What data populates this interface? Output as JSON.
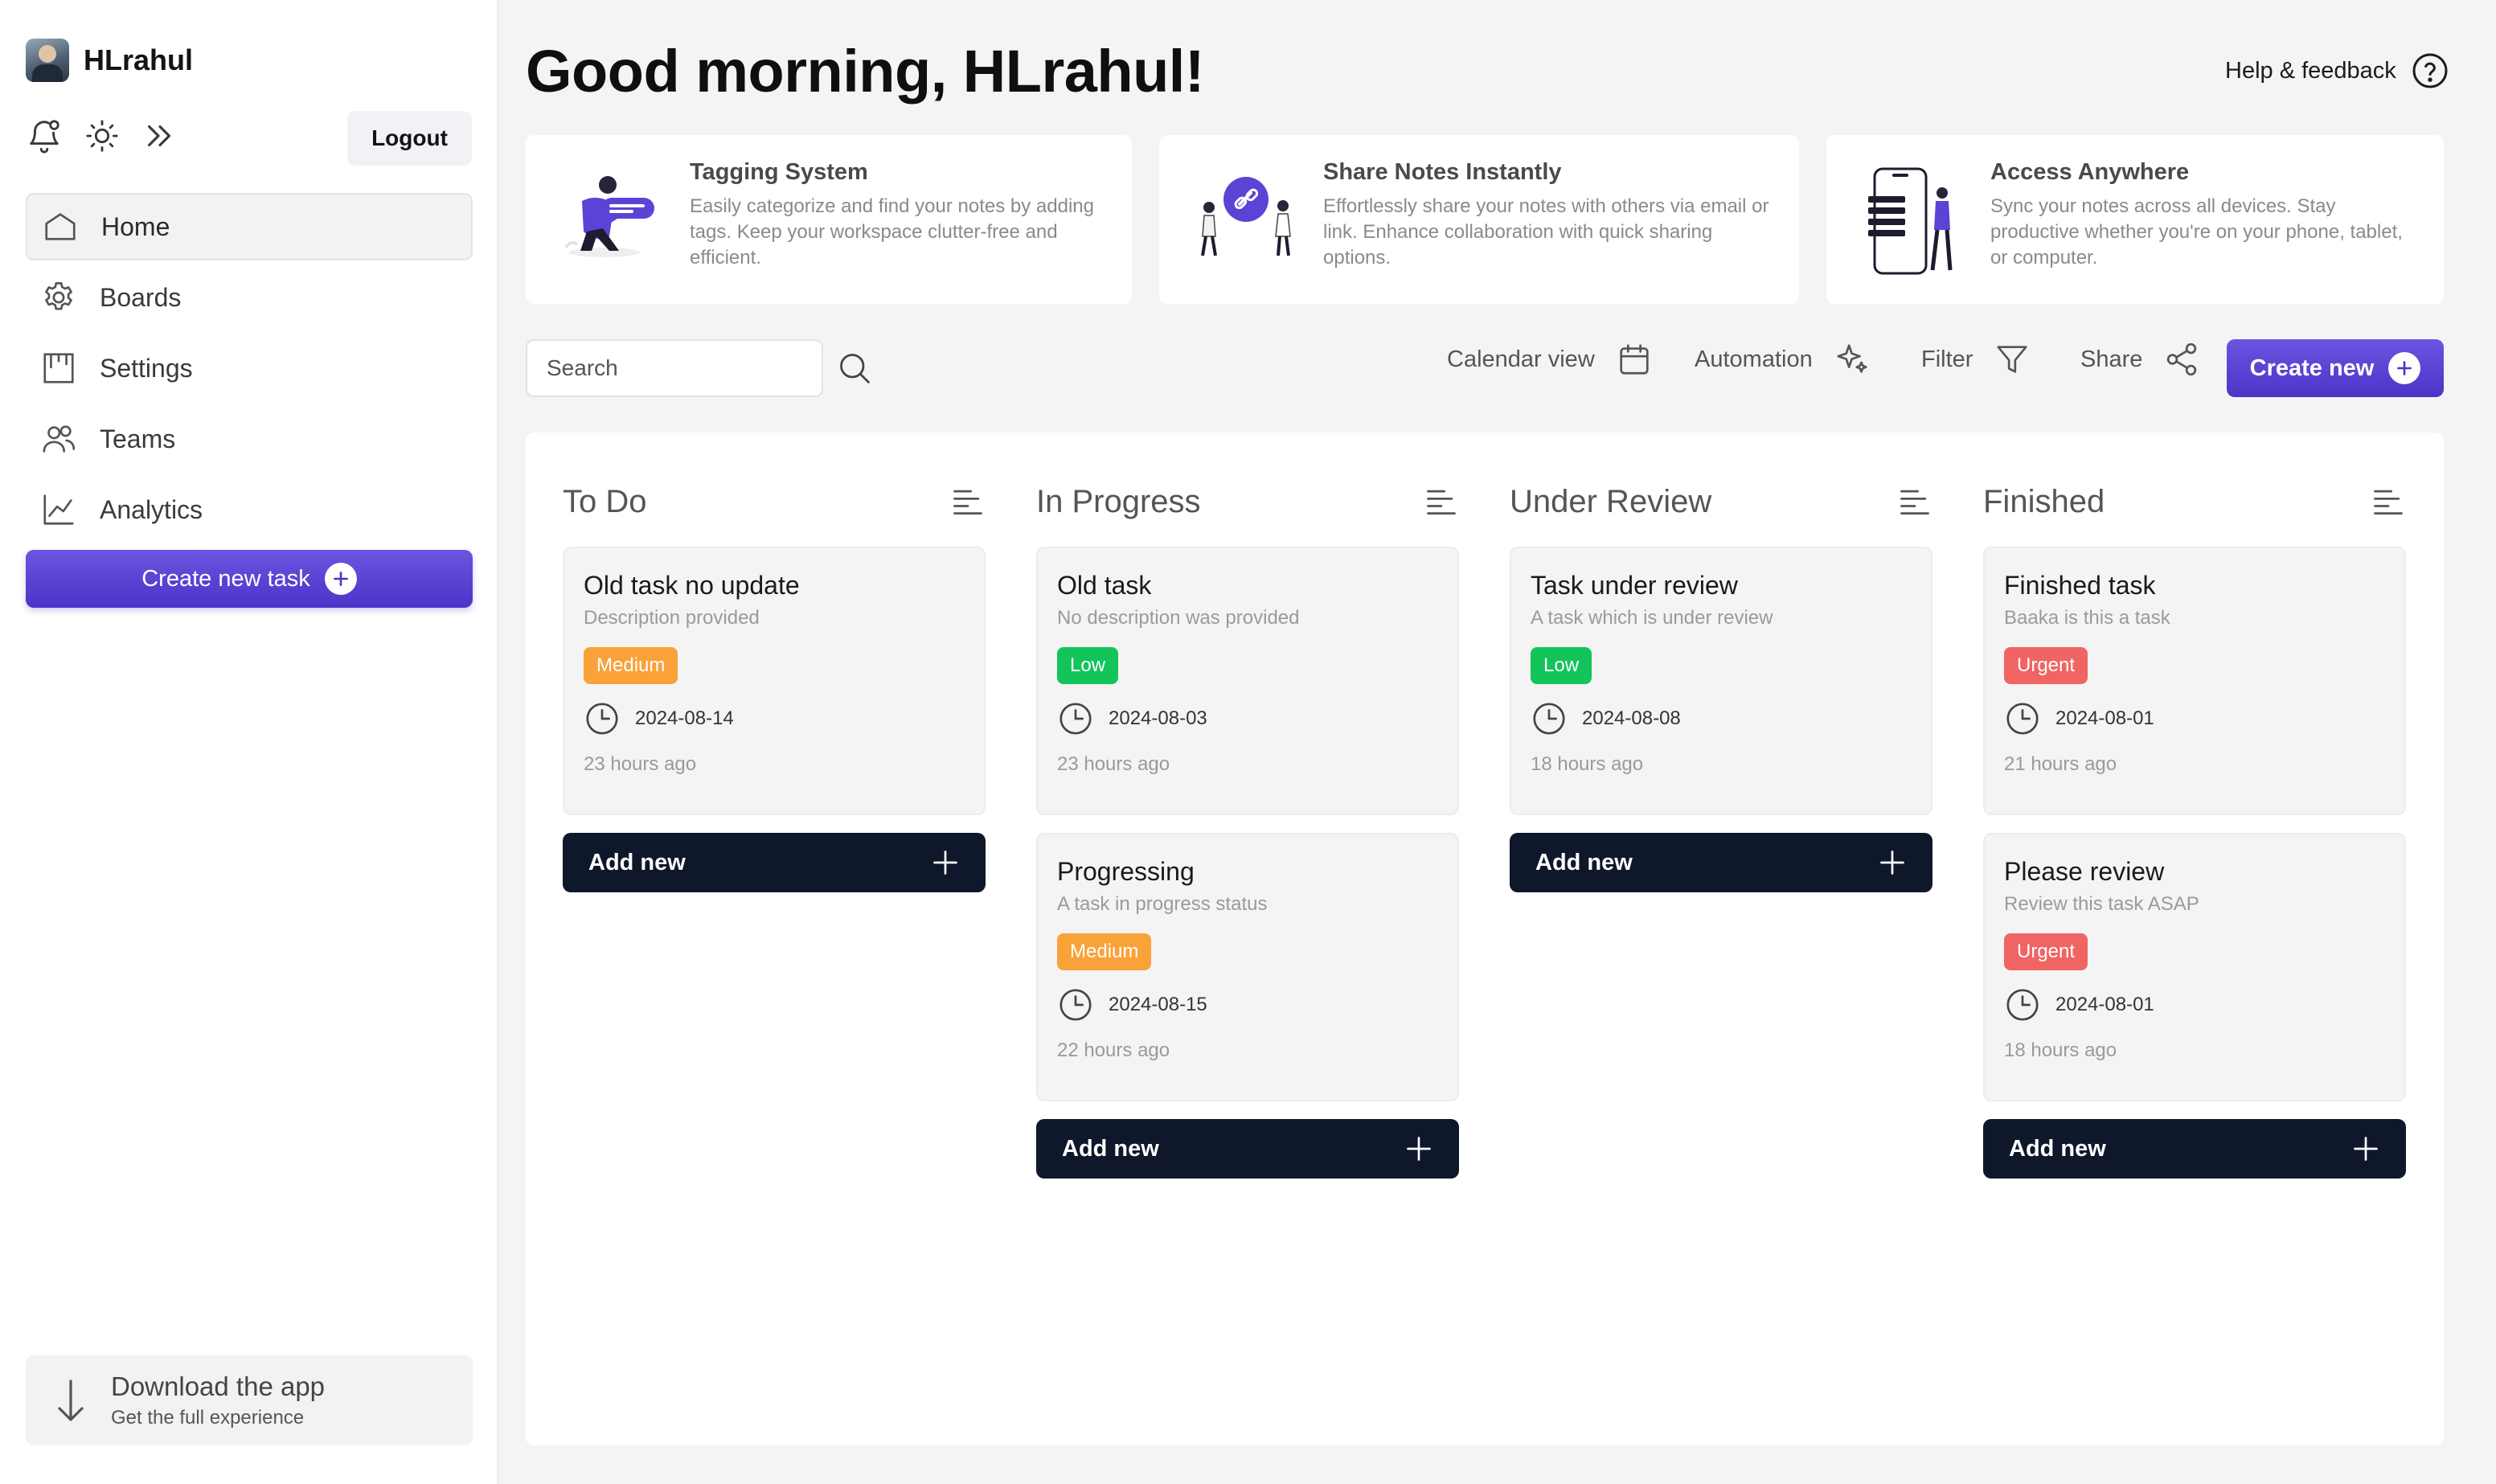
{
  "user": {
    "name": "HLrahul"
  },
  "sidebar": {
    "logout_label": "Logout",
    "nav": [
      {
        "label": "Home",
        "icon": "home-icon",
        "active": true
      },
      {
        "label": "Boards",
        "icon": "gear-icon"
      },
      {
        "label": "Settings",
        "icon": "kanban-icon"
      },
      {
        "label": "Teams",
        "icon": "users-icon"
      },
      {
        "label": "Analytics",
        "icon": "chart-line-icon"
      }
    ],
    "create_task_label": "Create new task",
    "download": {
      "title": "Download the app",
      "subtitle": "Get the full experience"
    }
  },
  "header": {
    "greeting": "Good morning, HLrahul!",
    "help_label": "Help & feedback"
  },
  "features": [
    {
      "title": "Tagging System",
      "description": "Easily categorize and find your notes by adding tags. Keep your workspace clutter-free and efficient."
    },
    {
      "title": "Share Notes Instantly",
      "description": "Effortlessly share your notes with others via email or link. Enhance collaboration with quick sharing options."
    },
    {
      "title": "Access Anywhere",
      "description": "Sync your notes across all devices. Stay productive whether you're on your phone, tablet, or computer."
    }
  ],
  "toolbar": {
    "search_placeholder": "Search",
    "calendar_label": "Calendar view",
    "automation_label": "Automation",
    "filter_label": "Filter",
    "share_label": "Share",
    "create_new_label": "Create new"
  },
  "colors": {
    "accent": "#5a44d6",
    "dark_button": "#0f172a",
    "medium": "#f9a23a",
    "low": "#12c45a",
    "urgent": "#f06464"
  },
  "board": {
    "add_label": "Add new",
    "columns": [
      {
        "title": "To Do",
        "tasks": [
          {
            "title": "Old task no update",
            "description": "Description provided",
            "priority": "Medium",
            "date": "2024-08-14",
            "ago": "23 hours ago"
          }
        ]
      },
      {
        "title": "In Progress",
        "tasks": [
          {
            "title": "Old task",
            "description": "No description was provided",
            "priority": "Low",
            "date": "2024-08-03",
            "ago": "23 hours ago"
          },
          {
            "title": "Progressing",
            "description": "A task in progress status",
            "priority": "Medium",
            "date": "2024-08-15",
            "ago": "22 hours ago"
          }
        ]
      },
      {
        "title": "Under Review",
        "tasks": [
          {
            "title": "Task under review",
            "description": "A task which is under review",
            "priority": "Low",
            "date": "2024-08-08",
            "ago": "18 hours ago"
          }
        ]
      },
      {
        "title": "Finished",
        "tasks": [
          {
            "title": "Finished task",
            "description": "Baaka is this a task",
            "priority": "Urgent",
            "date": "2024-08-01",
            "ago": "21 hours ago"
          },
          {
            "title": "Please review",
            "description": "Review this task ASAP",
            "priority": "Urgent",
            "date": "2024-08-01",
            "ago": "18 hours ago"
          }
        ]
      }
    ]
  }
}
